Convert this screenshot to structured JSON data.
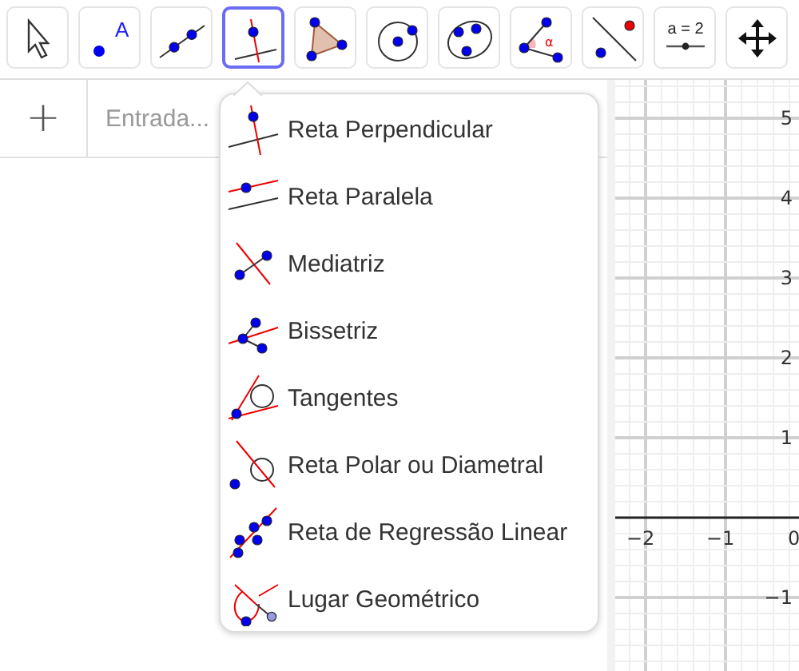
{
  "toolbar": {
    "tools": [
      {
        "kind": "move",
        "selected": false
      },
      {
        "kind": "point",
        "selected": false,
        "label": "A"
      },
      {
        "kind": "line",
        "selected": false
      },
      {
        "kind": "perpendicular",
        "selected": true
      },
      {
        "kind": "polygon",
        "selected": false
      },
      {
        "kind": "circle",
        "selected": false
      },
      {
        "kind": "conic",
        "selected": false
      },
      {
        "kind": "angle",
        "selected": false,
        "label": "α"
      },
      {
        "kind": "reflect",
        "selected": false
      },
      {
        "kind": "slider",
        "selected": false,
        "label": "a = 2"
      },
      {
        "kind": "pan",
        "selected": false
      }
    ]
  },
  "algebra": {
    "add": "+",
    "placeholder": "Entrada..."
  },
  "menu": {
    "items": [
      {
        "kind": "perpendicular",
        "label": "Reta Perpendicular"
      },
      {
        "kind": "parallel",
        "label": "Reta Paralela"
      },
      {
        "kind": "bisector",
        "label": "Mediatriz"
      },
      {
        "kind": "angle_bisector",
        "label": "Bissetriz"
      },
      {
        "kind": "tangents",
        "label": "Tangentes"
      },
      {
        "kind": "polar",
        "label": "Reta Polar ou Diametral"
      },
      {
        "kind": "regression",
        "label": "Reta de Regressão Linear"
      },
      {
        "kind": "locus",
        "label": "Lugar Geométrico"
      }
    ]
  },
  "graphics": {
    "x_labels": [
      "−2",
      "−1",
      "0"
    ],
    "y_labels": [
      "5",
      "4",
      "3",
      "2",
      "1",
      "−1"
    ]
  }
}
